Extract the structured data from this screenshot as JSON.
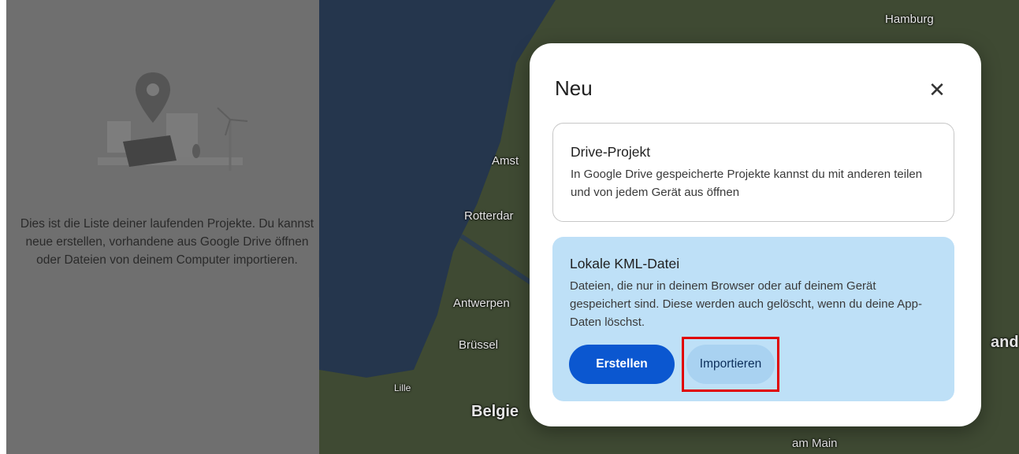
{
  "sidebar": {
    "empty_state_text": "Dies ist die Liste deiner laufenden Projekte. Du kannst neue erstellen, vorhandene aus Google Drive öffnen oder Dateien von deinem Computer importieren.",
    "collapse_icon": "◂"
  },
  "map": {
    "labels": {
      "hamburg": "Hamburg",
      "amsterdam": "Amst",
      "rotterdam": "Rotterdar",
      "antwerpen": "Antwerpen",
      "bruessel": "Brüssel",
      "lille": "Lille",
      "belgien": "Belgie",
      "frankfurt": "am Main",
      "land": "and"
    }
  },
  "dialog": {
    "title": "Neu",
    "close_icon": "✕",
    "drive_project": {
      "title": "Drive-Projekt",
      "description": "In Google Drive gespeicherte Projekte kannst du mit anderen teilen und von jedem Gerät aus öffnen"
    },
    "local_kml": {
      "title": "Lokale KML-Datei",
      "description": "Dateien, die nur in deinem Browser oder auf deinem Gerät gespeichert sind. Diese werden auch gelöscht, wenn du deine App-Daten löschst.",
      "create_label": "Erstellen",
      "import_label": "Importieren"
    }
  },
  "colors": {
    "primary_button": "#0b57d0",
    "tonal_button": "#a9d2f1",
    "selected_card": "#bee0f7",
    "highlight": "#e00000"
  }
}
